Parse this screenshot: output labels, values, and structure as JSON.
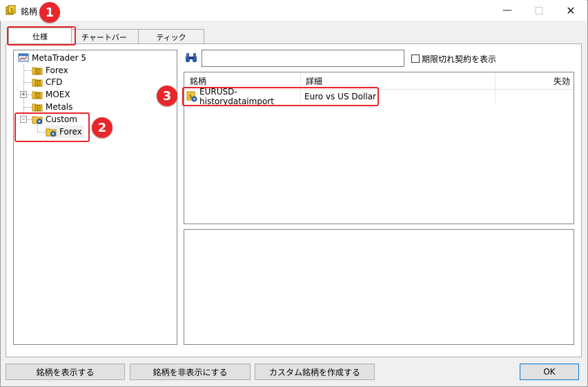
{
  "window": {
    "title": "銘柄",
    "icon": "coins-icon"
  },
  "tabs": [
    {
      "label": "仕様",
      "active": true
    },
    {
      "label": "チャートバー",
      "active": false
    },
    {
      "label": "ティック",
      "active": false
    }
  ],
  "tree": {
    "root": "MetaTrader 5",
    "items": [
      {
        "label": "Forex"
      },
      {
        "label": "CFD"
      },
      {
        "label": "MOEX"
      },
      {
        "label": "Metals"
      },
      {
        "label": "Custom"
      },
      {
        "label": "Forex"
      }
    ]
  },
  "search": {
    "value": "",
    "placeholder": ""
  },
  "show_expired": {
    "label": "期限切れ契約を表示",
    "checked": false
  },
  "table": {
    "columns": [
      "銘柄",
      "詳細",
      "失効"
    ],
    "rows": [
      {
        "symbol": "EURUSD-historydataimport",
        "description": "Euro vs US Dollar",
        "expiration": ""
      }
    ]
  },
  "buttons": {
    "show": "銘柄を表示する",
    "hide": "銘柄を非表示にする",
    "create": "カスタム銘柄を作成する",
    "ok": "OK"
  },
  "annotations": [
    "1",
    "2",
    "3"
  ],
  "colors": {
    "highlight": "#e8262b",
    "focus_border": "#0078d7"
  }
}
